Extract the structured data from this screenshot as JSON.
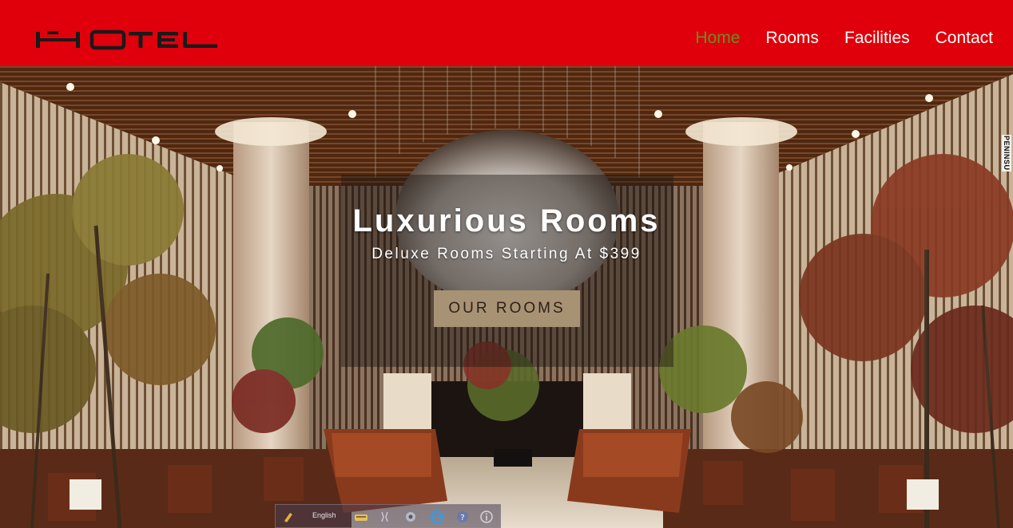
{
  "header": {
    "logo_text": "HOTEL",
    "nav": [
      {
        "label": "Home",
        "active": true
      },
      {
        "label": "Rooms",
        "active": false
      },
      {
        "label": "Facilities",
        "active": false
      },
      {
        "label": "Contact",
        "active": false
      }
    ],
    "background_color": "#e0000b",
    "active_color": "#6b8e23"
  },
  "hero": {
    "title": "Luxurious Rooms",
    "subtitle": "Deluxe Rooms Starting At $399",
    "cta_label": "OUR ROOMS",
    "cta_color": "#a89274",
    "image_subject": "hotel lobby with chandelier, pillars, trees and lounge seating",
    "side_stamp": "PENINSU"
  },
  "widget_bar": {
    "language": "English",
    "icons": [
      "pen-icon",
      "keyboard-icon",
      "tools-icon",
      "gear-icon",
      "browser-icon",
      "help-icon",
      "info-icon"
    ]
  }
}
